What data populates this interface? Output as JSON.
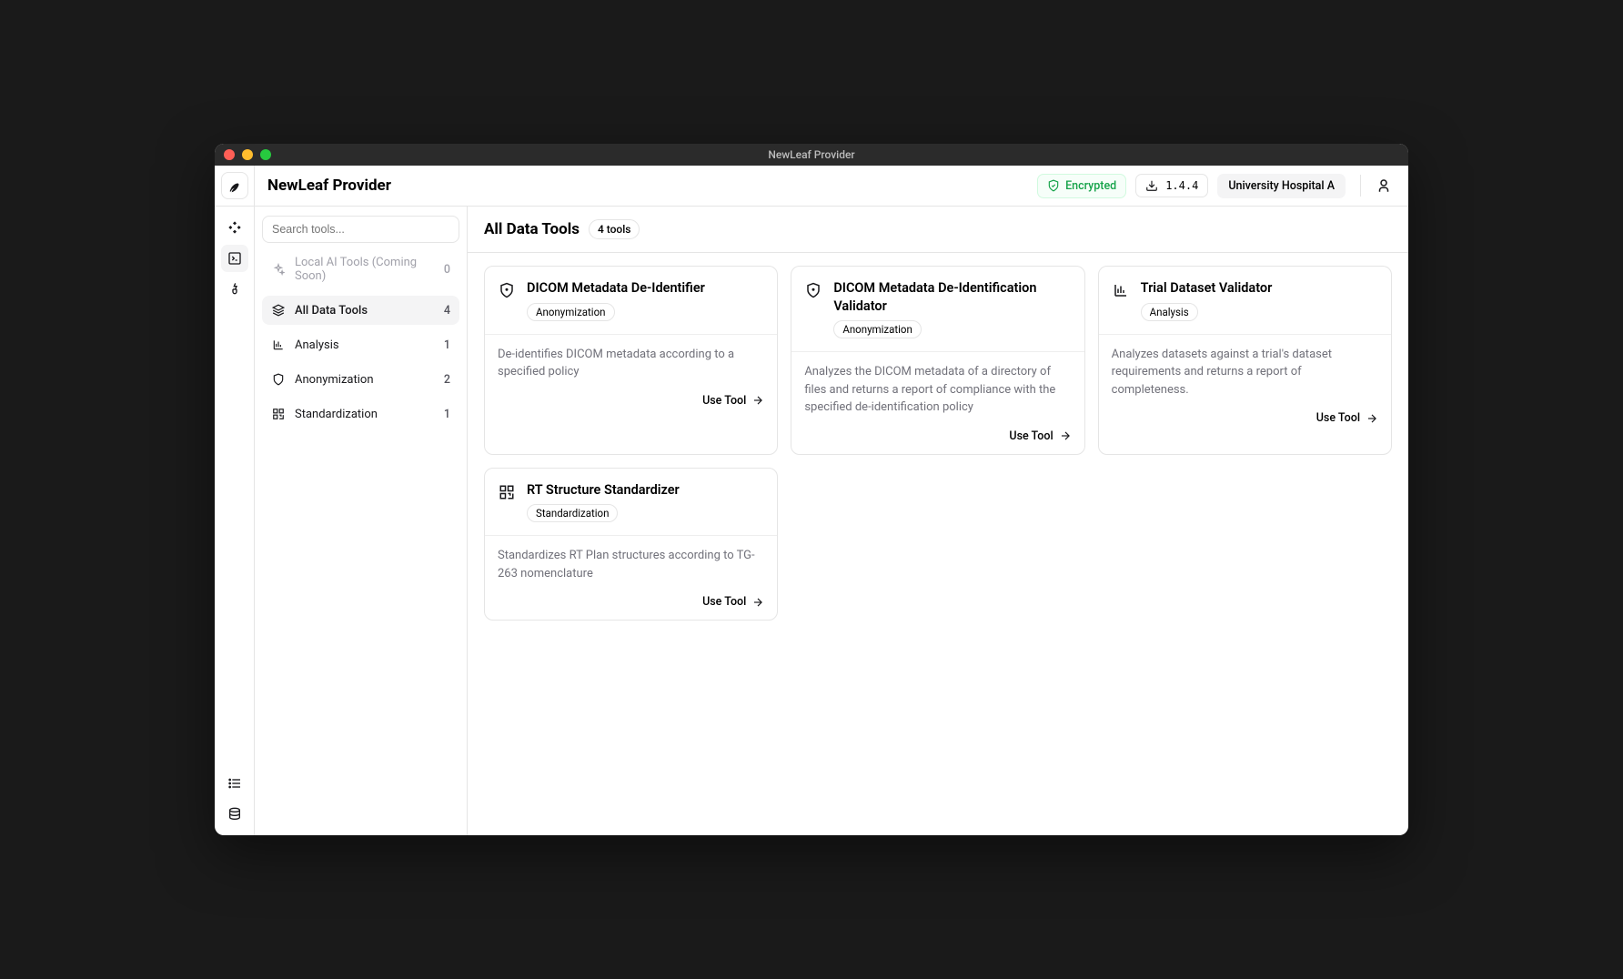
{
  "window": {
    "title": "NewLeaf Provider"
  },
  "header": {
    "app_title": "NewLeaf Provider",
    "encrypted": "Encrypted",
    "version": "1.4.4",
    "org": "University Hospital A"
  },
  "sidebar": {
    "search_placeholder": "Search tools...",
    "local_ai": {
      "label": "Local AI Tools (Coming Soon)",
      "count": "0"
    },
    "categories": [
      {
        "label": "All Data Tools",
        "count": "4"
      },
      {
        "label": "Analysis",
        "count": "1"
      },
      {
        "label": "Anonymization",
        "count": "2"
      },
      {
        "label": "Standardization",
        "count": "1"
      }
    ]
  },
  "main": {
    "title": "All Data Tools",
    "count_badge": "4 tools",
    "use_tool_label": "Use Tool"
  },
  "tools": [
    {
      "title": "DICOM Metadata De-Identifier",
      "tag": "Anonymization",
      "desc": "De-identifies DICOM metadata according to a specified policy",
      "icon": "shield"
    },
    {
      "title": "DICOM Metadata De-Identification Validator",
      "tag": "Anonymization",
      "desc": "Analyzes the DICOM metadata of a directory of files and returns a report of compliance with the specified de-identification policy",
      "icon": "shield"
    },
    {
      "title": "Trial Dataset Validator",
      "tag": "Analysis",
      "desc": "Analyzes datasets against a trial's dataset requirements and returns a report of completeness.",
      "icon": "barchart"
    },
    {
      "title": "RT Structure Standardizer",
      "tag": "Standardization",
      "desc": "Standardizes RT Plan structures according to TG-263 nomenclature",
      "icon": "qr"
    }
  ]
}
